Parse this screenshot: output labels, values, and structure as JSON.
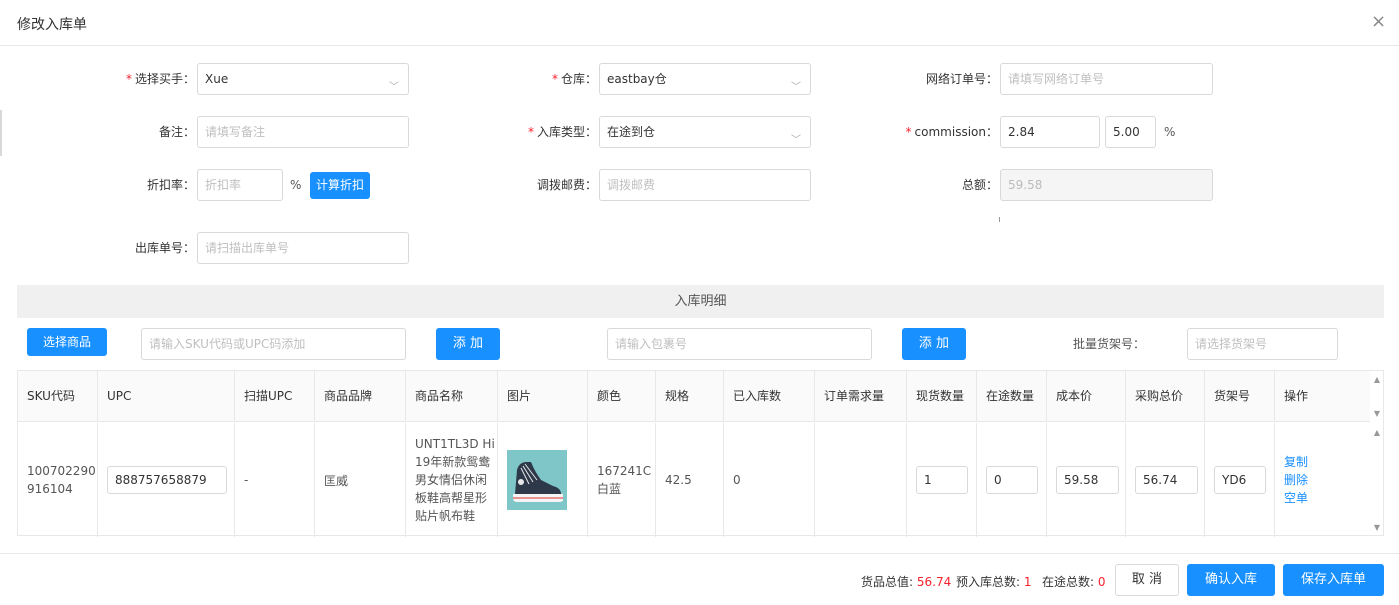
{
  "dialog": {
    "title": "修改入库单"
  },
  "form": {
    "buyer": {
      "label": "选择买手",
      "value": "Xue"
    },
    "warehouse": {
      "label": "仓库",
      "value": "eastbay仓"
    },
    "online_order": {
      "label": "网络订单号",
      "placeholder": "请填写网络订单号"
    },
    "remark": {
      "label": "备注",
      "placeholder": "请填写备注"
    },
    "inbound_type": {
      "label": "入库类型",
      "value": "在途到仓"
    },
    "commission": {
      "label": "commission",
      "value": "2.84",
      "rate": "5.00",
      "unit": "%"
    },
    "discount": {
      "label": "折扣率",
      "placeholder": "折扣率",
      "unit": "%",
      "button": "计算折扣"
    },
    "transfer_postage": {
      "label": "调拨邮费",
      "placeholder": "调拨邮费"
    },
    "total": {
      "label": "总额",
      "value": "59.58"
    },
    "outbound_no": {
      "label": "出库单号",
      "placeholder": "请扫描出库单号"
    }
  },
  "detail": {
    "title": "入库明细",
    "select_goods_button": "选择商品",
    "sku_input_placeholder": "请输入SKU代码或UPC码添加",
    "add_button": "添 加",
    "package_placeholder": "请输入包裹号",
    "add_button_2": "添 加",
    "batch_shelf_label": "批量货架号：",
    "batch_shelf_placeholder": "请选择货架号"
  },
  "table": {
    "headers": [
      "SKU代码",
      "UPC",
      "扫描UPC",
      "商品品牌",
      "商品名称",
      "图片",
      "颜色",
      "规格",
      "已入库数",
      "订单需求量",
      "现货数量",
      "在途数量",
      "成本价",
      "采购总价",
      "货架号",
      "操作"
    ],
    "row": {
      "sku_line1": "100702290",
      "sku_line2": "916104",
      "upc": "888757658879",
      "scan_upc": "-",
      "brand": "匡威",
      "name_lines": [
        "UNT1TL3D Hi",
        "19年新款鸳鸯",
        "男女情侣休闲",
        "板鞋高帮星形",
        "贴片帆布鞋"
      ],
      "color_line1": "167241C",
      "color_line2": "白蓝",
      "size": "42.5",
      "received": "0",
      "order_demand": "",
      "stock_qty": "1",
      "transit_qty": "0",
      "cost": "59.58",
      "purchase_total": "56.74",
      "shelf": "YD6",
      "actions": [
        "复制",
        "删除",
        "空单"
      ]
    }
  },
  "footer": {
    "goods_total_label": "货品总值:",
    "goods_total": "56.74",
    "pre_inbound_label": "预入库总数:",
    "pre_inbound": "1",
    "in_transit_label": "在途总数:",
    "in_transit": "0",
    "cancel": "取 消",
    "confirm": "确认入库",
    "save": "保存入库单"
  },
  "colors": {
    "primary": "#1890ff",
    "required": "#f5222d"
  }
}
